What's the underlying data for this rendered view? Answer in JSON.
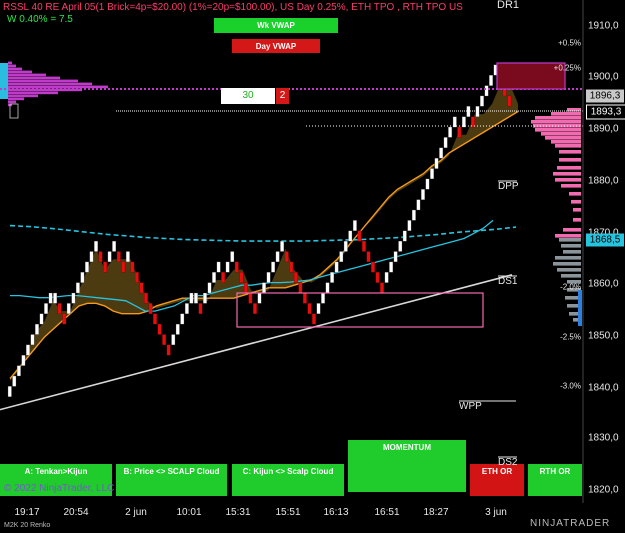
{
  "header": {
    "instrument_line": "RSSL 40 RE April 05(1 Brick=4p=$20.00) (1%=20p=$100.00), US Day 0.25%, ETH TPO , RTH TPO US",
    "w_line": "W 0.40% = 7.5",
    "dr_label": "DR1"
  },
  "vwap_buttons": {
    "week": "Wk VWAP",
    "day": "Day VWAP"
  },
  "counter": {
    "value": "30",
    "badge": "2"
  },
  "bottom_buttons": [
    {
      "label": "A: Tenkan>Kijun",
      "color": "#1fcc2b"
    },
    {
      "label": "B: Price <> SCALP Cloud",
      "color": "#1fcc2b"
    },
    {
      "label": "C: Kijun <> Scalp Cloud",
      "color": "#1fcc2b"
    },
    {
      "label": "MOMENTUM",
      "color": "#1fcc2b"
    },
    {
      "label": "ETH OR",
      "color": "#d31414"
    },
    {
      "label": "RTH OR",
      "color": "#1fcc2b"
    }
  ],
  "copyright": "© 2022 NinjaTrader, LLC",
  "bottom_left": "M2K 20 Renko",
  "logo": "NINJATRADER",
  "colors": {
    "up_brick": "#ffffff",
    "down_brick": "#e80e0e",
    "cloud": "#8b6a1f",
    "kijun": "#f59a1e",
    "tenkan": "#27c4e0",
    "vwap": "#27c4e0",
    "poc": "#c13bcb",
    "profile_pink": "#f26bb1",
    "profile_gray": "#8a949a",
    "trendline": "#d8d8d8"
  },
  "chart_data": {
    "type": "renko",
    "x_ticks": [
      "19:17",
      "20:54",
      "2 jun",
      "10:01",
      "15:31",
      "15:51",
      "16:13",
      "16:51",
      "18:27",
      "3 jun"
    ],
    "y_ticks": [
      1820,
      1830,
      1840,
      1850,
      1860,
      1870,
      1880,
      1890,
      1900,
      1910
    ],
    "y_tick_labels": [
      "1820,0",
      "1830,0",
      "1840,0",
      "1850,0",
      "1860,0",
      "1870,0",
      "1880,0",
      "1890,0",
      "1900,0",
      "1910,0"
    ],
    "ylim": [
      1817,
      1914
    ],
    "percent_ticks": [
      {
        "label": "+0.5%",
        "price": 1906.5
      },
      {
        "label": "+0.25%",
        "price": 1901.5
      },
      {
        "label": "-2.0%",
        "price": 1858.0
      },
      {
        "label": "-2.5%",
        "price": 1850.0
      },
      {
        "label": "-3.0%",
        "price": 1842.0
      }
    ],
    "levels": [
      {
        "label": "DPP",
        "price": 1881.5
      },
      {
        "label": "DS1",
        "price": 1861.0
      },
      {
        "label": "WPP",
        "price": 1837.5
      },
      {
        "label": "DS2",
        "price": 1823.5
      }
    ],
    "price_labels": [
      {
        "label": "1896,3",
        "price": 1896.3
      },
      {
        "label": "1893,3",
        "price": 1893.3
      },
      {
        "label": "1868,5",
        "price": 1868.5
      }
    ],
    "bricks": [
      1838.5,
      1840.5,
      1842.5,
      1844.5,
      1846.5,
      1848.5,
      1850.5,
      1852.5,
      1854.5,
      1856.5,
      1856.5,
      1854.5,
      1852.5,
      1854.5,
      1856.5,
      1858.5,
      1860.5,
      1862.5,
      1864.5,
      1866.5,
      1864.5,
      1862.5,
      1864.5,
      1866.5,
      1864.5,
      1862.5,
      1864.5,
      1862.5,
      1860.5,
      1858.5,
      1856.5,
      1854.5,
      1852.5,
      1850.5,
      1848.5,
      1846.5,
      1848.5,
      1850.5,
      1852.5,
      1854.5,
      1856.5,
      1856.5,
      1854.5,
      1856.5,
      1858.5,
      1860.5,
      1862.5,
      1860.5,
      1862.5,
      1864.5,
      1862.5,
      1860.5,
      1858.5,
      1856.5,
      1854.5,
      1856.5,
      1858.5,
      1860.5,
      1862.5,
      1864.5,
      1866.5,
      1864.5,
      1862.5,
      1860.5,
      1858.5,
      1856.5,
      1854.5,
      1852.5,
      1854.5,
      1856.5,
      1858.5,
      1860.5,
      1862.5,
      1864.5,
      1866.5,
      1868.5,
      1870.5,
      1868.5,
      1866.5,
      1864.5,
      1862.5,
      1860.5,
      1858.5,
      1860.5,
      1862.5,
      1864.5,
      1866.5,
      1868.5,
      1870.5,
      1872.5,
      1874.5,
      1876.5,
      1878.5,
      1880.5,
      1882.5,
      1884.5,
      1886.5,
      1888.5,
      1890.5,
      1888.5,
      1890.5,
      1892.5,
      1890.5,
      1892.5,
      1894.5,
      1896.5,
      1898.5,
      1900.5,
      1898.5,
      1896.5,
      1894.5
    ],
    "kijun": [
      1841,
      1843,
      1845,
      1847,
      1849,
      1850.5,
      1852,
      1853.5,
      1855,
      1855.5,
      1855.5,
      1855,
      1854,
      1853.5,
      1853.5,
      1853.5,
      1854,
      1855,
      1855.5,
      1856,
      1856.5,
      1856.5,
      1856.5,
      1856.5,
      1856.5,
      1856.5,
      1856.5,
      1857,
      1857.5,
      1858,
      1858.5,
      1858.5,
      1858.5,
      1859,
      1859.5,
      1860,
      1861,
      1862.5,
      1864,
      1866,
      1868,
      1870,
      1872,
      1874,
      1876,
      1877.5,
      1878.5,
      1879.5,
      1880.5,
      1882,
      1883,
      1884.5,
      1885.5,
      1886.5,
      1887.5,
      1888.5,
      1889.5,
      1890.5,
      1891.5,
      1892.5
    ],
    "tenkan": [
      1857,
      1857,
      1856.8,
      1856.6,
      1856.6,
      1856.8,
      1857,
      1857,
      1856.8,
      1856.6,
      1856.4,
      1856.2,
      1856,
      1855,
      1854,
      1854,
      1854.5,
      1855,
      1856,
      1857,
      1857,
      1857.5,
      1858,
      1858.5,
      1859,
      1859,
      1859.3,
      1859.5,
      1859.5,
      1859.6,
      1859.8,
      1860,
      1860.5,
      1861,
      1861.5,
      1862,
      1862.5,
      1863,
      1863.5,
      1864,
      1864.5,
      1865,
      1865.5,
      1866,
      1866.5,
      1867,
      1867.5,
      1868,
      1869,
      1870,
      1871.5
    ],
    "wk_vwap": [
      1870.5,
      1870.3,
      1870,
      1869.6,
      1869.2,
      1868.8,
      1868.5,
      1868.2,
      1868,
      1867.8,
      1867.7,
      1867.6,
      1867.5,
      1867.5,
      1867.5,
      1867.5,
      1867.6,
      1867.7,
      1867.8,
      1868,
      1868.2,
      1868.5,
      1868.8,
      1869.2,
      1869.5,
      1869.8,
      1870.2
    ],
    "trendline": {
      "start": 1835,
      "end": 1861
    }
  }
}
